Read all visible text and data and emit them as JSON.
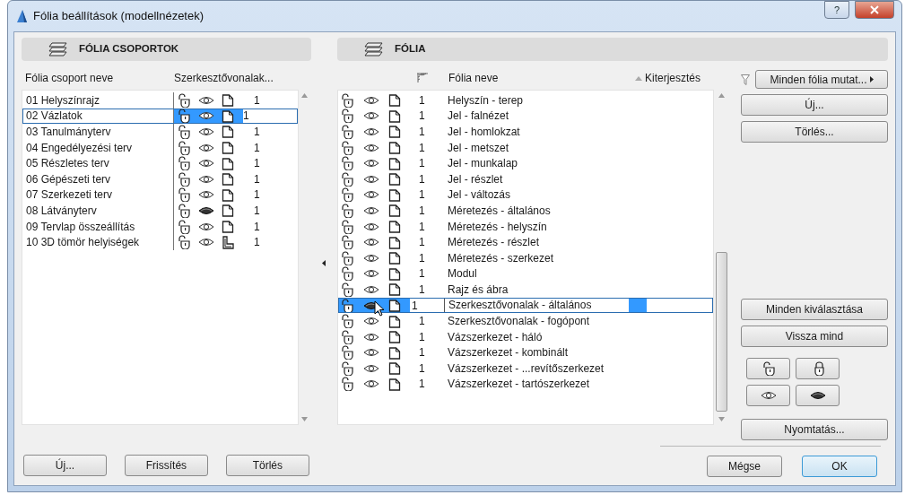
{
  "window": {
    "title": "Fólia beállítások (modellnézetek)",
    "help_button": "?"
  },
  "groups_panel": {
    "title": "FÓLIA CSOPORTOK",
    "columns": [
      "Fólia csoport neve",
      "Szerkesztővonalak..."
    ],
    "rows": [
      {
        "name": "01 Helyszínrajz",
        "locked": false,
        "visible": true,
        "solid": false,
        "pen": "1",
        "selected": false
      },
      {
        "name": "02 Vázlatok",
        "locked": false,
        "visible": true,
        "solid": false,
        "pen": "1",
        "selected": true
      },
      {
        "name": "03 Tanulmányterv",
        "locked": false,
        "visible": true,
        "solid": false,
        "pen": "1",
        "selected": false
      },
      {
        "name": "04 Engedélyezési terv",
        "locked": false,
        "visible": true,
        "solid": false,
        "pen": "1",
        "selected": false
      },
      {
        "name": "05 Részletes terv",
        "locked": false,
        "visible": true,
        "solid": false,
        "pen": "1",
        "selected": false
      },
      {
        "name": "06 Gépészeti terv",
        "locked": false,
        "visible": true,
        "solid": false,
        "pen": "1",
        "selected": false
      },
      {
        "name": "07 Szerkezeti terv",
        "locked": false,
        "visible": true,
        "solid": false,
        "pen": "1",
        "selected": false
      },
      {
        "name": "08 Látványterv",
        "locked": false,
        "visible": false,
        "solid": false,
        "pen": "1",
        "selected": false
      },
      {
        "name": "09 Tervlap összeállítás",
        "locked": false,
        "visible": true,
        "solid": false,
        "pen": "1",
        "selected": false
      },
      {
        "name": "10 3D tömör helyiségek",
        "locked": false,
        "visible": true,
        "solid": true,
        "pen": "1",
        "selected": false
      }
    ],
    "buttons": [
      "Új...",
      "Frissítés",
      "Törlés"
    ]
  },
  "layers_panel": {
    "title": "FÓLIA",
    "columns": [
      {
        "label": "Fólia neve",
        "sorted": false
      },
      {
        "label": "Kiterjesztés",
        "sorted": true
      }
    ],
    "rows": [
      {
        "name": "Helyszín - terep",
        "locked": false,
        "visible": true,
        "pen": "1",
        "selected": false
      },
      {
        "name": "Jel - falnézet",
        "locked": false,
        "visible": true,
        "pen": "1",
        "selected": false
      },
      {
        "name": "Jel - homlokzat",
        "locked": false,
        "visible": true,
        "pen": "1",
        "selected": false
      },
      {
        "name": "Jel - metszet",
        "locked": false,
        "visible": true,
        "pen": "1",
        "selected": false
      },
      {
        "name": "Jel - munkalap",
        "locked": false,
        "visible": true,
        "pen": "1",
        "selected": false
      },
      {
        "name": "Jel - részlet",
        "locked": false,
        "visible": true,
        "pen": "1",
        "selected": false
      },
      {
        "name": "Jel - változás",
        "locked": false,
        "visible": true,
        "pen": "1",
        "selected": false
      },
      {
        "name": "Méretezés - általános",
        "locked": false,
        "visible": true,
        "pen": "1",
        "selected": false
      },
      {
        "name": "Méretezés - helyszín",
        "locked": false,
        "visible": true,
        "pen": "1",
        "selected": false
      },
      {
        "name": "Méretezés - részlet",
        "locked": false,
        "visible": true,
        "pen": "1",
        "selected": false
      },
      {
        "name": "Méretezés - szerkezet",
        "locked": false,
        "visible": true,
        "pen": "1",
        "selected": false
      },
      {
        "name": "Modul",
        "locked": false,
        "visible": true,
        "pen": "1",
        "selected": false
      },
      {
        "name": "Rajz és ábra",
        "locked": false,
        "visible": true,
        "pen": "1",
        "selected": false
      },
      {
        "name": "Szerkesztővonalak - általános",
        "locked": false,
        "visible": false,
        "pen": "1",
        "selected": true
      },
      {
        "name": "Szerkesztővonalak - fogópont",
        "locked": false,
        "visible": true,
        "pen": "1",
        "selected": false
      },
      {
        "name": "Vázszerkezet - háló",
        "locked": false,
        "visible": true,
        "pen": "1",
        "selected": false
      },
      {
        "name": "Vázszerkezet - kombinált",
        "locked": false,
        "visible": true,
        "pen": "1",
        "selected": false
      },
      {
        "name": "Vázszerkezet - ...revítőszerkezet",
        "locked": false,
        "visible": true,
        "pen": "1",
        "selected": false
      },
      {
        "name": "Vázszerkezet - tartószerkezet",
        "locked": false,
        "visible": true,
        "pen": "1",
        "selected": false
      }
    ],
    "filter_button": "Minden fólia mutat...",
    "top_buttons": [
      "Új...",
      "Törlés..."
    ],
    "middle_buttons": [
      "Minden kiválasztása",
      "Vissza mind"
    ],
    "icon_buttons": [
      {
        "kind": "unlock"
      },
      {
        "kind": "lock"
      },
      {
        "kind": "show"
      },
      {
        "kind": "hide"
      }
    ],
    "print_button": "Nyomtatás..."
  },
  "dialog_buttons": [
    {
      "label": "Mégse",
      "default": false
    },
    {
      "label": "OK",
      "default": true
    }
  ]
}
